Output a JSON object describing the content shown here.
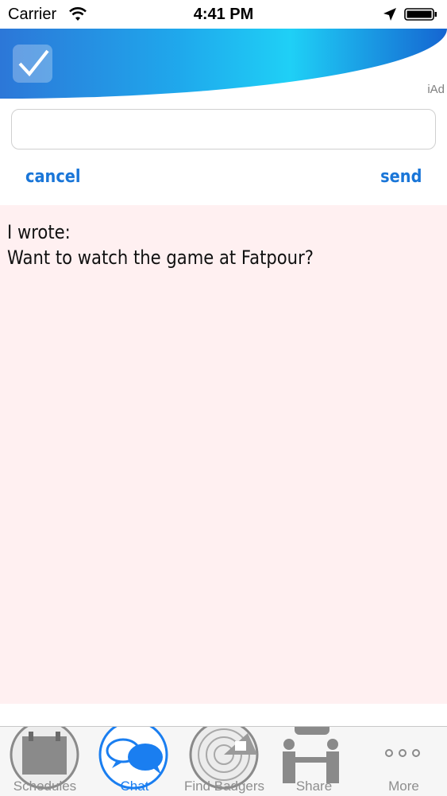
{
  "status_bar": {
    "carrier": "Carrier",
    "time": "4:41 PM",
    "icons": [
      "wifi-icon",
      "location-arrow-icon",
      "battery-icon"
    ]
  },
  "ad_banner": {
    "label": "iAd",
    "icon": "checkmark-icon",
    "colors": [
      "#2c77d8",
      "#1fd0f6",
      "#1565d1"
    ]
  },
  "compose": {
    "input_value": "",
    "cancel_label": "cancel",
    "send_label": "send",
    "accent_color": "#1a76d8"
  },
  "message": {
    "line1": "I wrote:",
    "line2": "Want to watch the game at Fatpour?",
    "background_color": "#fff0f1"
  },
  "tab_bar": {
    "active_tab": "Chat",
    "tabs": [
      {
        "label": "Schedules",
        "icon": "calendar-icon"
      },
      {
        "label": "Chat",
        "icon": "chat-bubbles-icon"
      },
      {
        "label": "Find Badgers",
        "icon": "radar-icon"
      },
      {
        "label": "Share",
        "icon": "people-share-icon"
      },
      {
        "label": "More",
        "icon": "more-dots-icon"
      }
    ]
  }
}
